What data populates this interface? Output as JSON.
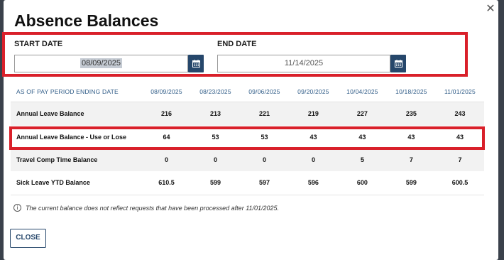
{
  "dialog": {
    "title": "Absence Balances",
    "close_glyph": "✕"
  },
  "filters": {
    "start_label": "START DATE",
    "start_value": "08/09/2025",
    "end_label": "END DATE",
    "end_value": "11/14/2025"
  },
  "table": {
    "header_label": "AS OF PAY PERIOD ENDING DATE",
    "dates": [
      "08/09/2025",
      "08/23/2025",
      "09/06/2025",
      "09/20/2025",
      "10/04/2025",
      "10/18/2025",
      "11/01/2025"
    ],
    "rows": [
      {
        "label": "Annual Leave Balance",
        "values": [
          "216",
          "213",
          "221",
          "219",
          "227",
          "235",
          "243"
        ]
      },
      {
        "label": "Annual Leave Balance - Use or Lose",
        "values": [
          "64",
          "53",
          "53",
          "43",
          "43",
          "43",
          "43"
        ]
      },
      {
        "label": "Travel Comp Time Balance",
        "values": [
          "0",
          "0",
          "0",
          "0",
          "5",
          "7",
          "7"
        ]
      },
      {
        "label": "Sick Leave YTD Balance",
        "values": [
          "610.5",
          "599",
          "597",
          "596",
          "600",
          "599",
          "600.5"
        ]
      }
    ]
  },
  "footer": {
    "info_text": "The current balance does not reflect requests that have been processed after 11/01/2025.",
    "close_label": "CLOSE"
  },
  "icons": {
    "calendar": "calendar-icon",
    "info": "info-icon",
    "close": "close-icon"
  },
  "colors": {
    "accent": "#26476b",
    "highlight": "#d9202a",
    "header_text": "#2d5a86"
  }
}
